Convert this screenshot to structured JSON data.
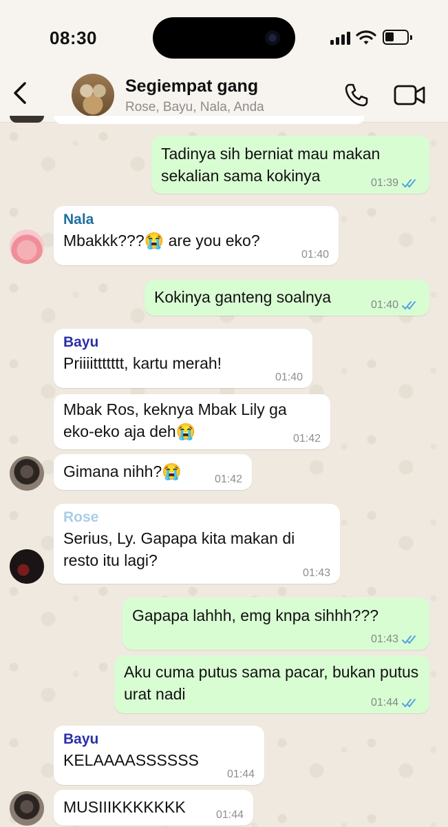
{
  "status_bar": {
    "time": "08:30"
  },
  "header": {
    "group_name": "Segiempat gang",
    "members": "Rose, Bayu, Nala, Anda"
  },
  "colors": {
    "outgoing_bubble": "#d9fdd3",
    "incoming_bubble": "#ffffff",
    "nala": "#1f6f9c",
    "bayu": "#2b2fa8",
    "rose": "#a9cde6",
    "read_ticks": "#4fa3e0"
  },
  "messages": [
    {
      "text": "Tadinya sih berniat mau makan sekalian sama kokinya",
      "time": "01:39"
    },
    {
      "sender": "Nala",
      "text": "Mbakkk???😭 are you eko?",
      "time": "01:40"
    },
    {
      "text": "Kokinya ganteng soalnya",
      "time": "01:40"
    },
    {
      "sender": "Bayu",
      "text": "Priiiittttttt, kartu merah!",
      "time": "01:40"
    },
    {
      "text": "Mbak Ros, keknya Mbak Lily ga eko-eko aja deh😭",
      "time": "01:42"
    },
    {
      "text": "Gimana nihh?😭",
      "time": "01:42"
    },
    {
      "sender": "Rose",
      "text": "Serius, Ly. Gapapa kita makan di resto itu lagi?",
      "time": "01:43"
    },
    {
      "text": "Gapapa lahhh, emg knpa sihhh???",
      "time": "01:43"
    },
    {
      "text": "Aku cuma putus sama pacar, bukan putus urat nadi",
      "time": "01:44"
    },
    {
      "sender": "Bayu",
      "text": "KELAAAASSSSSS",
      "time": "01:44"
    },
    {
      "text": "MUSIIIKKKKKKK",
      "time": "01:44"
    }
  ]
}
